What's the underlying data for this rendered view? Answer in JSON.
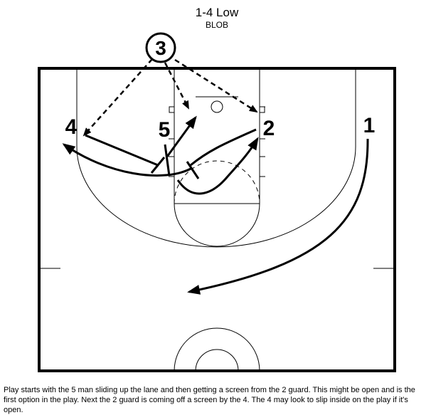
{
  "header": {
    "title": "1-4 Low",
    "subtitle": "BLOB"
  },
  "players": {
    "inbounder": "3",
    "p4": "4",
    "p5": "5",
    "p2": "2",
    "p1": "1"
  },
  "description": "Play starts with the 5 man sliding up the lane and then getting a screen from the 2 guard. This might be open and is the first option in the play. Next the 2 guard is coming off a screen by the 4. The 4 may look to slip inside on the play if it's open."
}
